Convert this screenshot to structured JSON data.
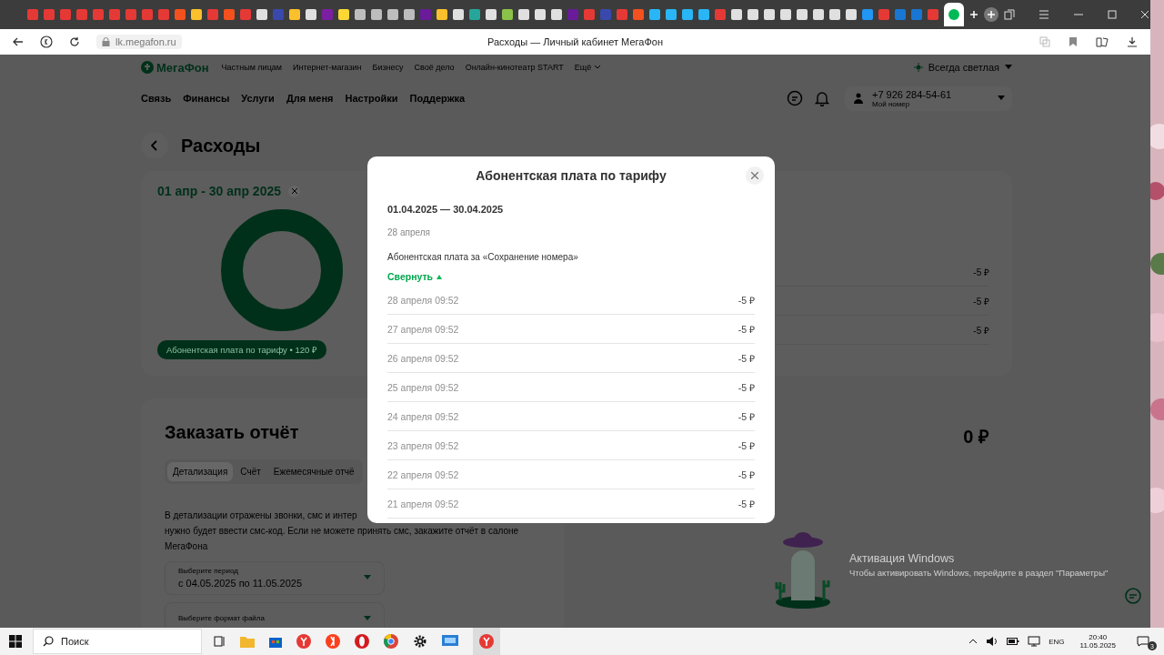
{
  "browser": {
    "address": "lk.megafon.ru",
    "page_title": "Расходы — Личный кабинет МегаФон"
  },
  "header": {
    "logo": "МегаФон",
    "top_links": [
      "Частным лицам",
      "Интернет-магазин",
      "Бизнесу",
      "Своё дело",
      "Онлайн-кинотеатр START",
      "Ещё"
    ],
    "theme": "Всегда светлая",
    "main_nav": [
      "Связь",
      "Финансы",
      "Услуги",
      "Для меня",
      "Настройки",
      "Поддержка"
    ],
    "phone": "+7 926 284-54-61",
    "phone_caption": "Мой номер"
  },
  "page_title": "Расходы",
  "summary": {
    "period": "01 апр - 30 апр 2025",
    "category": "Абонентская плата по тарифу • 120 ₽"
  },
  "charges_preview": [
    "-5 ₽",
    "-5 ₽",
    "-5 ₽"
  ],
  "report": {
    "title": "Заказать отчёт",
    "total": "0 ₽",
    "tabs": [
      {
        "label": "Детализация",
        "selected": true
      },
      {
        "label": "Счёт",
        "selected": false
      },
      {
        "label": "Ежемесячные отчё",
        "selected": false
      }
    ],
    "description": [
      "В детализации отражены звонки, смс и интер",
      "нужно будет ввести смс-код. Если не можете принять смс, закажите отчёт в салоне",
      "МегаФона"
    ],
    "fields": [
      {
        "label": "Выберите период",
        "value": "с 04.05.2025 по 11.05.2025"
      },
      {
        "label": "Выберите формат файла"
      }
    ]
  },
  "modal": {
    "title": "Абонентская плата по тарифу",
    "period": "01.04.2025 — 30.04.2025",
    "date": "28 апреля",
    "description": "Абонентская плата за «Сохранение номера»",
    "toggle": "Свернуть",
    "expanded": true,
    "rows": [
      {
        "time": "28 апреля 09:52",
        "amount": "-5 ₽"
      },
      {
        "time": "27 апреля 09:52",
        "amount": "-5 ₽"
      },
      {
        "time": "26 апреля 09:52",
        "amount": "-5 ₽"
      },
      {
        "time": "25 апреля 09:52",
        "amount": "-5 ₽"
      },
      {
        "time": "24 апреля 09:52",
        "amount": "-5 ₽"
      },
      {
        "time": "23 апреля 09:52",
        "amount": "-5 ₽"
      },
      {
        "time": "22 апреля 09:52",
        "amount": "-5 ₽"
      },
      {
        "time": "21 апреля 09:52",
        "amount": "-5 ₽"
      }
    ]
  },
  "os_notice": {
    "title": "Активация Windows",
    "text": "Чтобы активировать Windows, перейдите в раздел \"Параметры\""
  },
  "taskbar": {
    "search": "Поиск",
    "language": "ENG",
    "time": "20:40",
    "date": "11.05.2025",
    "notifications": "3"
  }
}
